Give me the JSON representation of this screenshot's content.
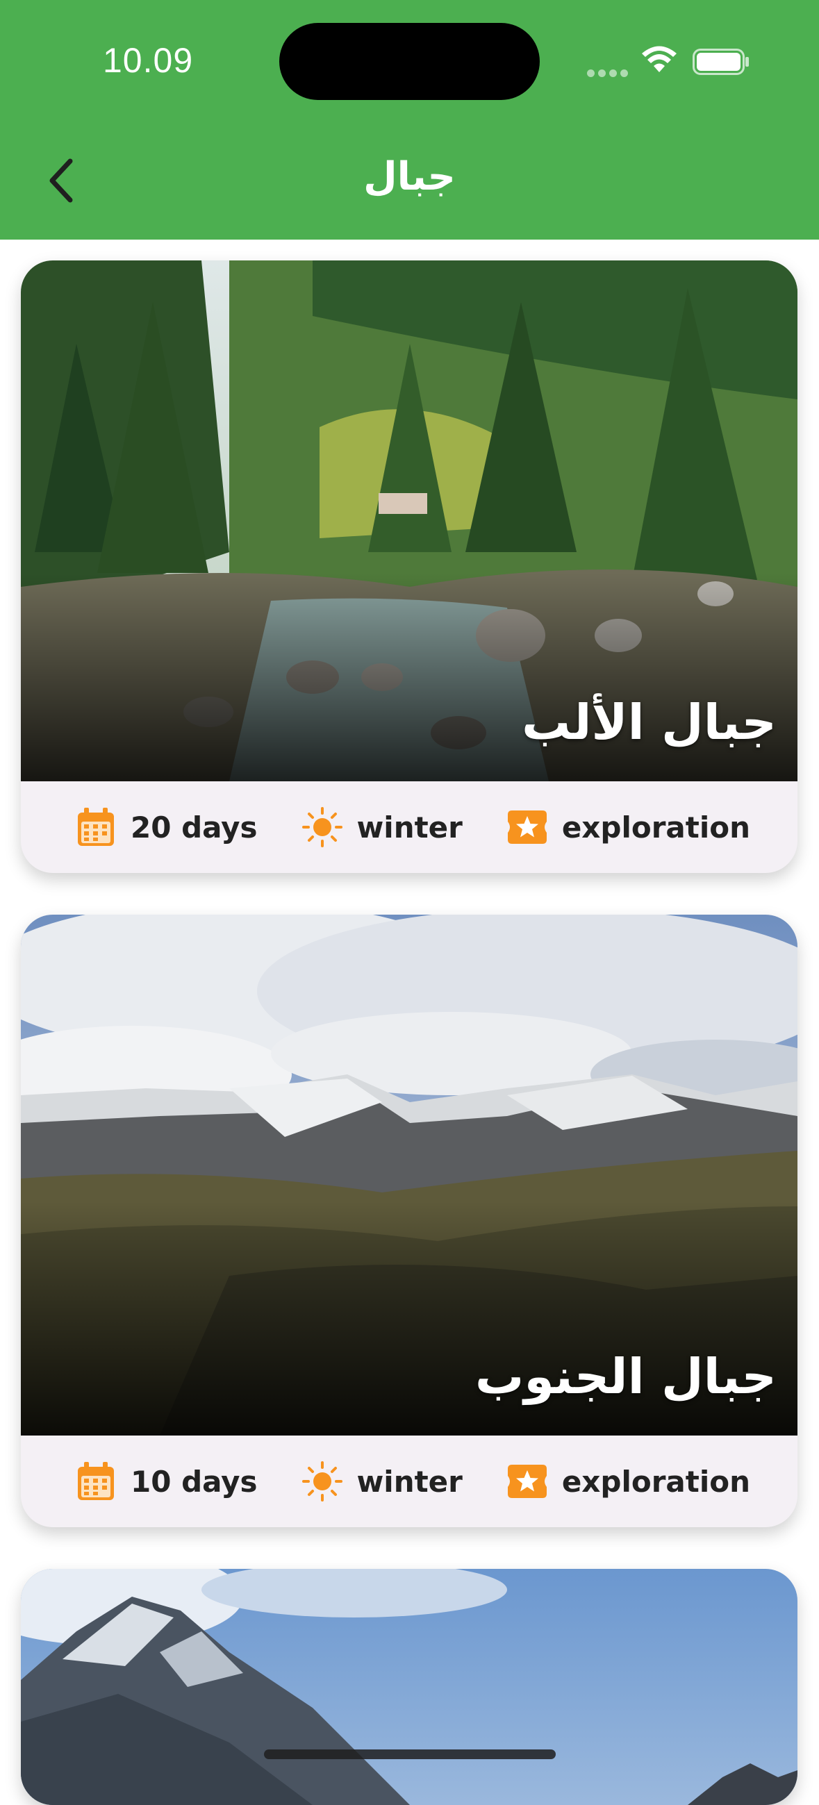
{
  "status": {
    "time": "10.09"
  },
  "header": {
    "title": "جبال"
  },
  "accent": "#4caf50",
  "icon_color": "#f7931e",
  "cards": [
    {
      "name": "جبال الألب",
      "duration": "20 days",
      "season": "winter",
      "type": "exploration"
    },
    {
      "name": "جبال الجنوب",
      "duration": "10 days",
      "season": "winter",
      "type": "exploration"
    }
  ],
  "icons": [
    "chevron-left-icon",
    "calendar-icon",
    "sun-icon",
    "star-badge-icon",
    "wifi-icon",
    "battery-icon"
  ]
}
